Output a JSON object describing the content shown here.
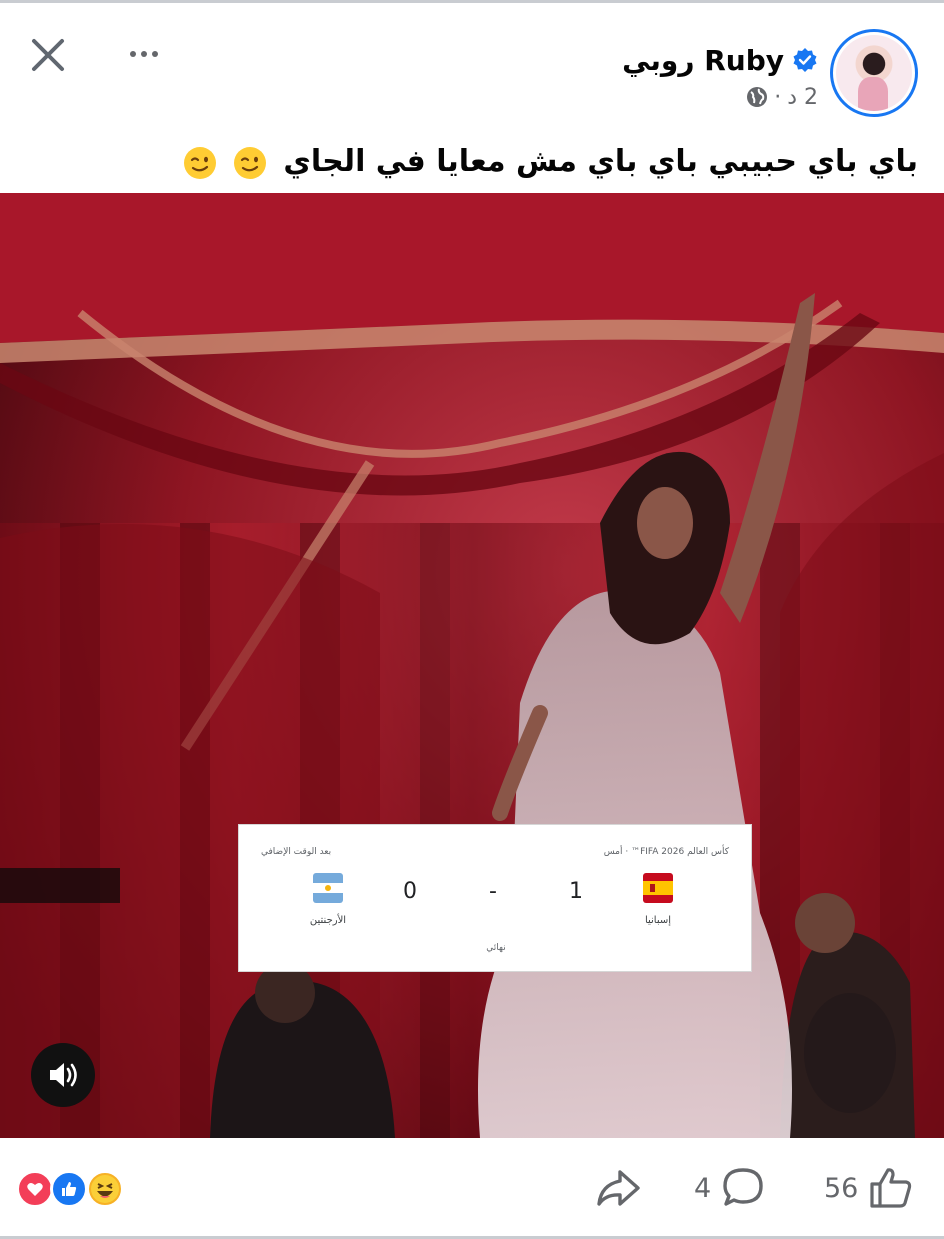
{
  "post": {
    "author_name": "روبي Ruby",
    "verified": true,
    "time": "2 د",
    "separator": "·",
    "privacy_icon": "globe-icon",
    "caption": "باي باي حبيبي باي باي مش معايا في الجاي",
    "caption_emojis": [
      "wink-emoji",
      "wink-emoji"
    ]
  },
  "header": {
    "close_icon": "close-icon",
    "more_icon": "more-options-icon"
  },
  "video": {
    "sound_icon": "speaker-icon",
    "scorecard": {
      "competition": "كأس العالم FIFA 2026™ · أمس",
      "period_note": "بعد الوقت الإضافي",
      "team_left": "إسبانيا",
      "team_right": "الأرجنتين",
      "score_left": "1",
      "score_right": "0",
      "dash": "-",
      "status": "نهائي",
      "colors": {
        "spain_red": "#c60b1e",
        "spain_yellow": "#ffc400",
        "argentina_blue": "#75aadb"
      }
    }
  },
  "footer": {
    "reaction_icons": [
      "love-reaction-icon",
      "like-reaction-icon",
      "haha-reaction-icon"
    ],
    "comments_count": "4",
    "likes_count": "56",
    "share_icon": "share-icon",
    "comment_icon": "comment-icon",
    "like_icon": "like-icon"
  },
  "colors": {
    "accent": "#1877f2",
    "text": "#050505",
    "muted": "#65676b"
  }
}
